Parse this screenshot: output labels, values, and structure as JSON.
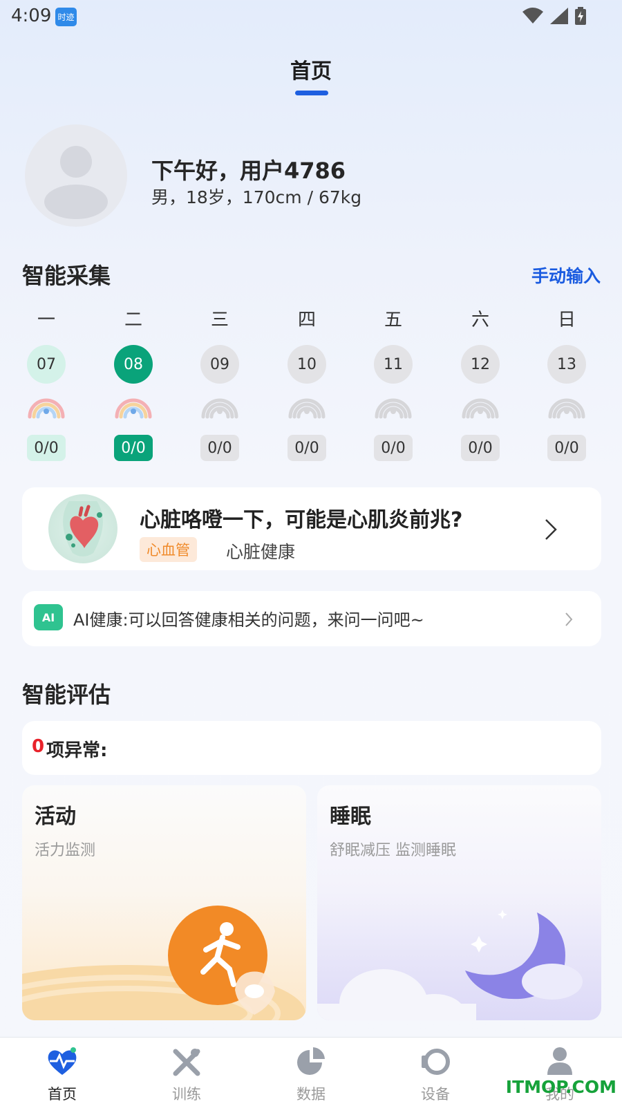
{
  "status_bar": {
    "time": "4:09",
    "app_badge": "时迹"
  },
  "header": {
    "title": "首页"
  },
  "profile": {
    "greeting": "下午好，用户4786",
    "info": "男，18岁，170cm / 67kg"
  },
  "collection": {
    "title": "智能采集",
    "manual_input": "手动输入",
    "days": [
      {
        "weekday": "一",
        "date": "07",
        "count": "0/0",
        "state": "past"
      },
      {
        "weekday": "二",
        "date": "08",
        "count": "0/0",
        "state": "active"
      },
      {
        "weekday": "三",
        "date": "09",
        "count": "0/0",
        "state": "future"
      },
      {
        "weekday": "四",
        "date": "10",
        "count": "0/0",
        "state": "future"
      },
      {
        "weekday": "五",
        "date": "11",
        "count": "0/0",
        "state": "future"
      },
      {
        "weekday": "六",
        "date": "12",
        "count": "0/0",
        "state": "future"
      },
      {
        "weekday": "日",
        "date": "13",
        "count": "0/0",
        "state": "future"
      }
    ]
  },
  "article": {
    "title": "心脏咯噔一下，可能是心肌炎前兆?",
    "tag": "心血管",
    "category": "心脏健康"
  },
  "ai": {
    "icon_text": "AI",
    "text": "AI健康:可以回答健康相关的问题，来问一问吧~"
  },
  "assessment": {
    "title": "智能评估",
    "abnormal_count": "0",
    "abnormal_label": "项异常:",
    "cards": [
      {
        "title": "活动",
        "subtitle": "活力监测"
      },
      {
        "title": "睡眠",
        "subtitle": "舒眠减压 监测睡眠"
      }
    ]
  },
  "nav": {
    "items": [
      {
        "label": "首页",
        "icon": "heartbeat-icon",
        "active": true
      },
      {
        "label": "训练",
        "icon": "training-icon",
        "active": false
      },
      {
        "label": "数据",
        "icon": "pie-chart-icon",
        "active": false
      },
      {
        "label": "设备",
        "icon": "device-icon",
        "active": false
      },
      {
        "label": "我的",
        "icon": "user-icon",
        "active": false
      }
    ]
  },
  "watermark": "ITMOP.COM",
  "colors": {
    "accent": "#1e5fe0",
    "green": "#0aa37a",
    "red": "#e8222a",
    "orange": "#f08a2a"
  }
}
